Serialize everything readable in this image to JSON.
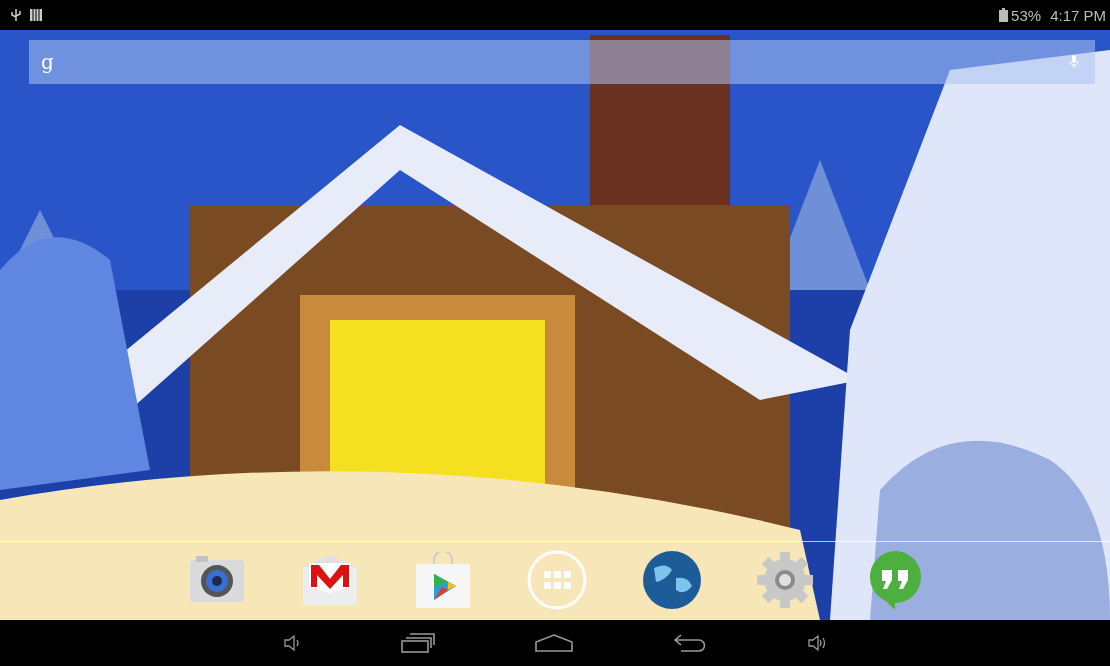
{
  "status_bar": {
    "battery": "53%",
    "time": "4:17 PM"
  },
  "search": {
    "logo": "g"
  },
  "dock": [
    {
      "kind": "camera"
    },
    {
      "kind": "mail"
    },
    {
      "kind": "store"
    },
    {
      "kind": "apps"
    },
    {
      "kind": "globe"
    },
    {
      "kind": "settings"
    },
    {
      "kind": "chat"
    }
  ],
  "nav_bar": [
    {
      "kind": "volume-down"
    },
    {
      "kind": "recents"
    },
    {
      "kind": "home"
    },
    {
      "kind": "back"
    },
    {
      "kind": "volume-up"
    }
  ]
}
